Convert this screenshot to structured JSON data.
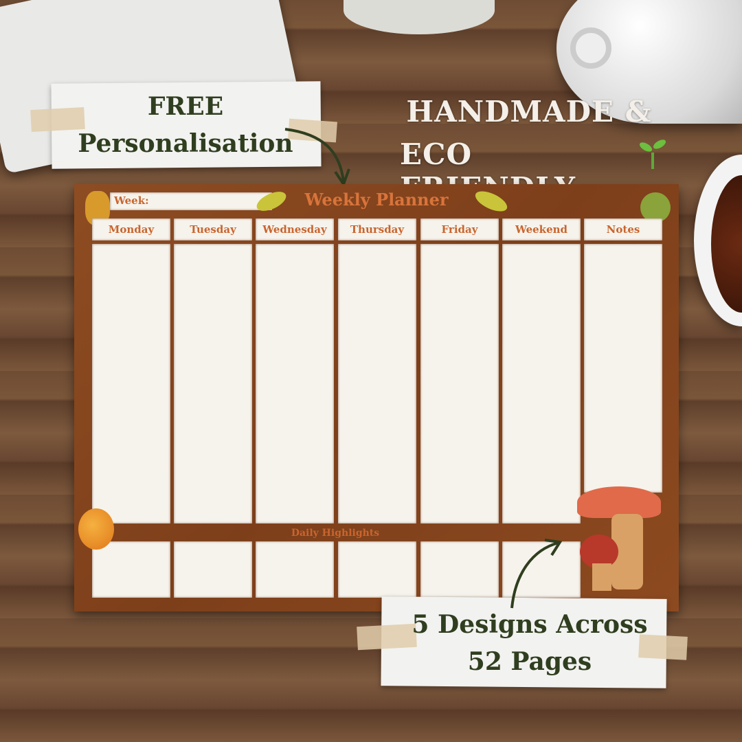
{
  "callouts": {
    "personalisation": [
      "FREE",
      "Personalisation"
    ],
    "eco": [
      "HANDMADE &",
      "ECO FRIENDLY"
    ],
    "designs": [
      "5 Designs Across",
      "52 Pages"
    ]
  },
  "planner": {
    "week_label": "Week:",
    "title": "Weekly Planner",
    "columns": [
      "Monday",
      "Tuesday",
      "Wednesday",
      "Thursday",
      "Friday",
      "Weekend",
      "Notes"
    ],
    "daily_highlights": "Daily Highlights"
  },
  "icons": [
    "sprout-icon",
    "arrow-icon",
    "pinecone-icon",
    "leaf-icon",
    "chestnut-icon",
    "pumpkin-icon",
    "mushroom-icon"
  ],
  "colors": {
    "planner_bg": "#8a4620",
    "heading": "#c9652e",
    "label_text": "#2f3e1f"
  }
}
